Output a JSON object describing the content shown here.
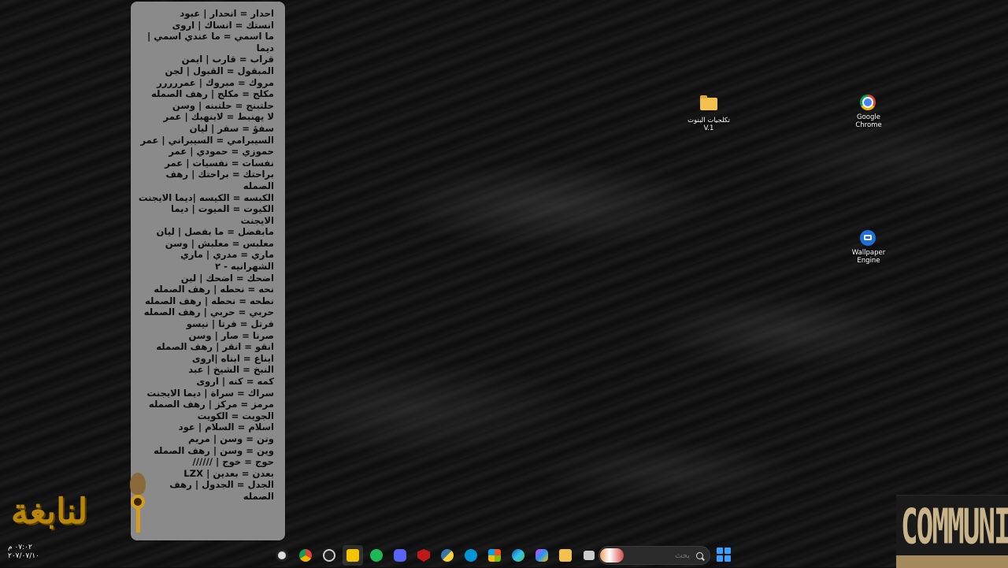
{
  "sticky_note": {
    "lines": [
      "احدار = انحدار | عبود",
      "انستك = انساك | اروى",
      "ما اسمي = ما عندي اسمي | ديما",
      "قراب = قارب | ايمن",
      "المبقول = القبول | لجن",
      "مروك = مبروك | عمررررر",
      "مكلج = مكلج | رهف الصمله",
      "حلتبنج = حلتبنه | وسن",
      "لا يهنبط = لابنهبك | عمر",
      "سفؤ = سفر | ليان",
      "السيبرامي = السيبراني | عمر",
      "حموزي = حمودي | عمر",
      "نفسات = نفسيات | عمر",
      "براحتك = براحتك | رهف الصمله",
      "الكبسه = الكيسه |ديما الايجنت",
      "الكيوت = الميوت | ديما الايجنت",
      "مابفضل = ما بفصل | ليان",
      "معلبس = معلبش | وسن",
      "ماري = مدري | ماري الشهرانيه - ٢",
      "اضحك = اضحك | لين",
      "نحه = نحطه | رهف الصمله",
      "نطحه = نحطه | رهف الصمله",
      "حربي = حربي | رهف الصمله",
      "فرتل = فرتا | نيسو",
      "صرنا = صار | وسن",
      "انقو = انقر | رهف الصمله",
      "ابناع = ابناه |اروى",
      "النبخ = الشيخ | عبد",
      "كمه = كنه | اروى",
      "سراك = سراة | ديما الايجنت",
      "مرمز = مركز | رهف الصمله",
      "الجويت = الكويت",
      "اسلام = السلام | عود",
      "وتن = وسن | مريم",
      "وين = وسن | رهف الصمله",
      "حوج = خوج | //////",
      "بعدن = بعدين | LZX",
      "الجدل = الجدول | رهف الصمله"
    ]
  },
  "desktop_icons": [
    {
      "name": "folder",
      "label": "تكلجيات البنوت V.1"
    },
    {
      "name": "chrome",
      "label": "Google Chrome"
    },
    {
      "name": "wallpaper-engine",
      "label": "Wallpaper Engine"
    }
  ],
  "logo_left_text": "لنابغة",
  "logo_right_text": "COMMUNITY",
  "clock": {
    "time": "٠٧:٠٢ م",
    "date": "٢٠٧/٠٧/١٠"
  },
  "search": {
    "placeholder": "بحث"
  },
  "taskbar_icons": [
    "gear-icon",
    "chrome-icon",
    "obs-icon",
    "sticky-notes-icon",
    "spotify-icon",
    "discord-icon",
    "mcafee-icon",
    "python-icon",
    "hp-icon",
    "store-icon",
    "edge-icon",
    "copilot-icon",
    "file-explorer-icon",
    "task-view-icon"
  ]
}
